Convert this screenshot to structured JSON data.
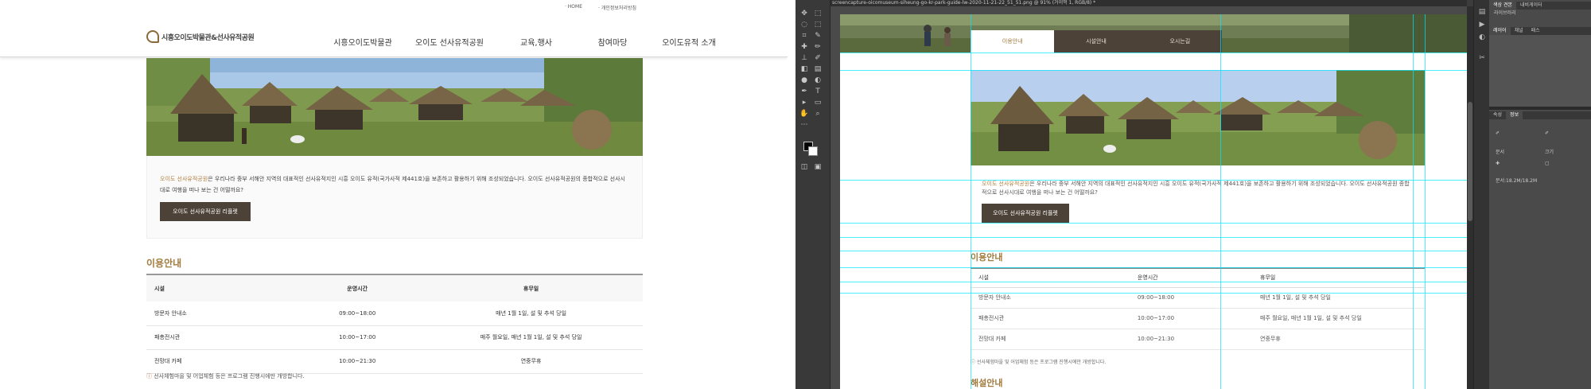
{
  "site": {
    "util_links": [
      "HOME",
      "개인정보처리방침"
    ],
    "logo_text": "시흥오이도박물관&선사유적공원",
    "nav": [
      "시흥오이도박물관",
      "오이도 선사유적공원",
      "교육,행사",
      "참여마당",
      "오이도유적 소개"
    ],
    "desc_highlight": "오이도 선사유적공원",
    "desc_text": "은 우리나라 중부 서해안 지역의 대표적인 선사유적지인 시흥 오이도 유적(국가사적 제441호)을 보존하고 활용하기 위해 조성되었습니다. 오이도 선사유적공원의 종합적으로 선사시대로 여행을 떠나 보는 건 어떨까요?",
    "desc_button": "오이도 선사유적공원 리플렛",
    "section_title": "이용안내",
    "table": {
      "headers": [
        "시설",
        "운영시간",
        "휴무일"
      ],
      "rows": [
        [
          "방문자 안내소",
          "09:00~18:00",
          "매년 1월 1일, 설 및 추석 당일"
        ],
        [
          "패총전시관",
          "10:00~17:00",
          "매주 월요일, 매년 1월 1일, 설 및 추석 당일"
        ],
        [
          "전망대 카페",
          "10:00~21:30",
          "연중무휴"
        ]
      ]
    },
    "note": "선사체험마을 및 어업체험 등은 프로그램 진행시에만 개방합니다."
  },
  "ps": {
    "doc_tab": "screencapture-oicomuseum-siheung-go-kr-park-guide-lw-2020-11-21-22_51_51.png @ 91% (거이먹 1, RGB/8) *",
    "tabs": [
      "이용안내",
      "시설안내",
      "오시는길"
    ],
    "desc_highlight": "오이도 선사유적공원",
    "desc_text": "은 우리나라 중부 서해안 지역의 대표적인 선사유적지인 시흥 오이도 유적(국가사적 제441호)을 보존하고 활용하기 위해 조성되었습니다. 오이도 선사유적공원 종합적으로 선사시대로 여행을 떠나 보는 건 어떨까요?",
    "desc_button": "오이도 선사유적공원 리플렛",
    "section_title": "이용안내",
    "table": {
      "headers": [
        "시설",
        "운영시간",
        "휴무일"
      ],
      "rows": [
        [
          "방문자 안내소",
          "09:00~18:00",
          "매년 1월 1일, 설 및 추석 당일"
        ],
        [
          "패총전시관",
          "10:00~17:00",
          "매주 월요일, 매년 1월 1일, 설 및 추석 당일"
        ],
        [
          "전망대 카페",
          "10:00~21:30",
          "연중무휴"
        ]
      ]
    },
    "note": "선사체험마을 및 어업체험 등은 프로그램 진행시에만 개방합니다.",
    "section_title_2": "해설안내",
    "panel1_tabs": [
      "색상 견본",
      "내비게이터"
    ],
    "panel1_label": "라이브러리",
    "panel2_tabs": [
      "레이어",
      "채널",
      "패스"
    ],
    "panel3_tabs": [
      "속성",
      "정보"
    ],
    "panel3_labels": [
      "문서",
      "크기"
    ],
    "panel3_footer": "문서:18.2M/18.2M"
  },
  "colors": {
    "accent": "#a27a3c",
    "button_dark": "#4d4238",
    "guide": "#00e6ff"
  }
}
